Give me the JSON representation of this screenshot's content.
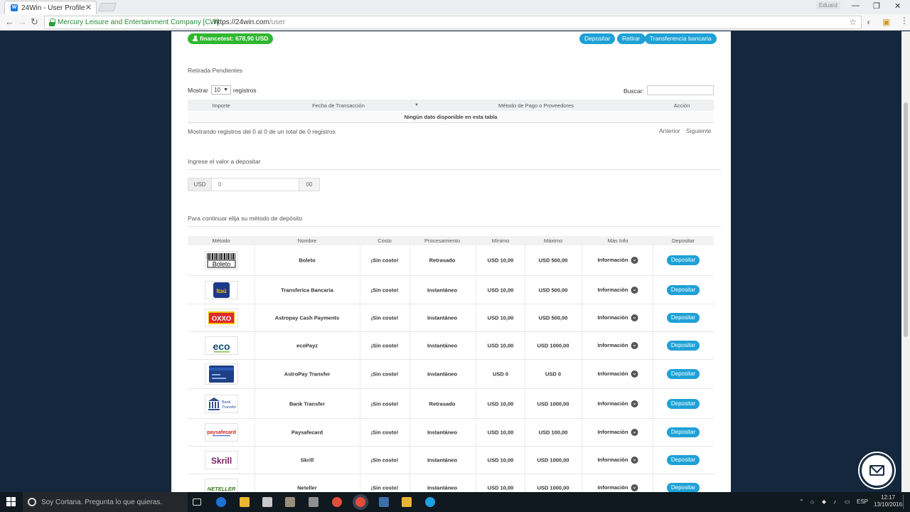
{
  "browser": {
    "tab_title": "24Win - User Profile",
    "profile_label": "Eduard",
    "org_name": "Mercury Leisure and Entertainment Company [CW]",
    "url_host": "https://24win.com",
    "url_path": "/user"
  },
  "header": {
    "balance": "financetest: 678,90 USD",
    "buttons": [
      "Depositar",
      "Retirar",
      "Transferencia bancaria"
    ]
  },
  "pending": {
    "title": "Retirada Pendientes",
    "show_prefix": "Mostrar",
    "show_value": "10",
    "show_suffix": "registros",
    "search_label": "Buscar:",
    "columns": [
      "Importe",
      "Fecha de Transacción",
      "Método de Pago o Proveedores",
      "Acción"
    ],
    "empty": "Ningún dato disponible en esta tabla",
    "showing": "Mostrando registros del 0 al 0 de un total de 0 registros",
    "prev": "Anterior",
    "next": "Siguiente"
  },
  "deposit": {
    "label": "Ingrese el valor a depositar",
    "currency": "USD",
    "value": "0",
    "cents": "00",
    "choose_label": "Para continuar elija su método de depósito"
  },
  "methods": {
    "columns": [
      "Método",
      "Nombre",
      "Costo",
      "Procesamiento",
      "Mínimo",
      "Máximo",
      "Más Info",
      "Depositar"
    ],
    "info_label": "Información",
    "button_label": "Depositar",
    "rows": [
      {
        "logo": "boleto",
        "logo_text": "Boleto",
        "name": "Boleto",
        "cost": "¡Sin costo!",
        "proc": "Retrasado",
        "min": "USD 10,00",
        "max": "USD 500,00"
      },
      {
        "logo": "itau",
        "logo_text": "Itaú",
        "name": "Transferica Bancaria",
        "cost": "¡Sin costo!",
        "proc": "Instantáneo",
        "min": "USD 10,00",
        "max": "USD 500,00"
      },
      {
        "logo": "oxxo",
        "logo_text": "OXXO",
        "name": "Astropay Cash Payments",
        "cost": "¡Sin costo!",
        "proc": "Instantáneo",
        "min": "USD 10,00",
        "max": "USD 500,00"
      },
      {
        "logo": "eco",
        "logo_text": "eco",
        "name": "ecoPayz",
        "cost": "¡Sin costo!",
        "proc": "Instantáneo",
        "min": "USD 10,00",
        "max": "USD 1000,00"
      },
      {
        "logo": "astropay-card",
        "logo_text": "",
        "name": "AstroPay Transfer",
        "cost": "¡Sin costo!",
        "proc": "Instantáneo",
        "min": "USD 0",
        "max": "USD 0"
      },
      {
        "logo": "bank",
        "logo_text": "Bank Transfer",
        "name": "Bank Transfer",
        "cost": "¡Sin costo!",
        "proc": "Retrasado",
        "min": "USD 10,00",
        "max": "USD 1000,00"
      },
      {
        "logo": "paysafe",
        "logo_text": "paysafecard",
        "name": "Paysafecard",
        "cost": "¡Sin costo!",
        "proc": "Instantáneo",
        "min": "USD 10,00",
        "max": "USD 100,00"
      },
      {
        "logo": "skrill",
        "logo_text": "Skrill",
        "name": "Skrill",
        "cost": "¡Sin costo!",
        "proc": "Instantáneo",
        "min": "USD 10,00",
        "max": "USD 1000,00"
      },
      {
        "logo": "neteller",
        "logo_text": "NETELLER",
        "name": "Neteller",
        "cost": "¡Sin costo!",
        "proc": "Instantáneo",
        "min": "USD 10,00",
        "max": "USD 1000,00"
      }
    ]
  },
  "taskbar": {
    "search_placeholder": "Soy Cortana. Pregunta lo que quieras.",
    "lang": "ESP",
    "time": "12:17",
    "date": "13/10/2016"
  },
  "colors": {
    "accent": "#1ea1d6",
    "balance": "#2eb82e",
    "background": "#14273d"
  }
}
